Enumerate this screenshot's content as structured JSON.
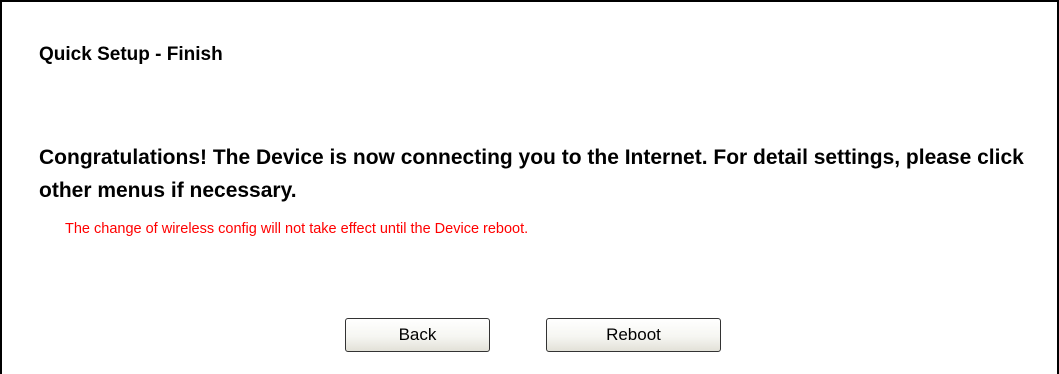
{
  "page": {
    "title": "Quick Setup - Finish",
    "message": "Congratulations! The Device is now connecting you to the Internet. For detail settings, please click other menus if necessary.",
    "notice": "The change of wireless config will not take effect until the Device reboot.",
    "notice_color": "#ff0000"
  },
  "buttons": {
    "back_label": "Back",
    "reboot_label": "Reboot"
  }
}
